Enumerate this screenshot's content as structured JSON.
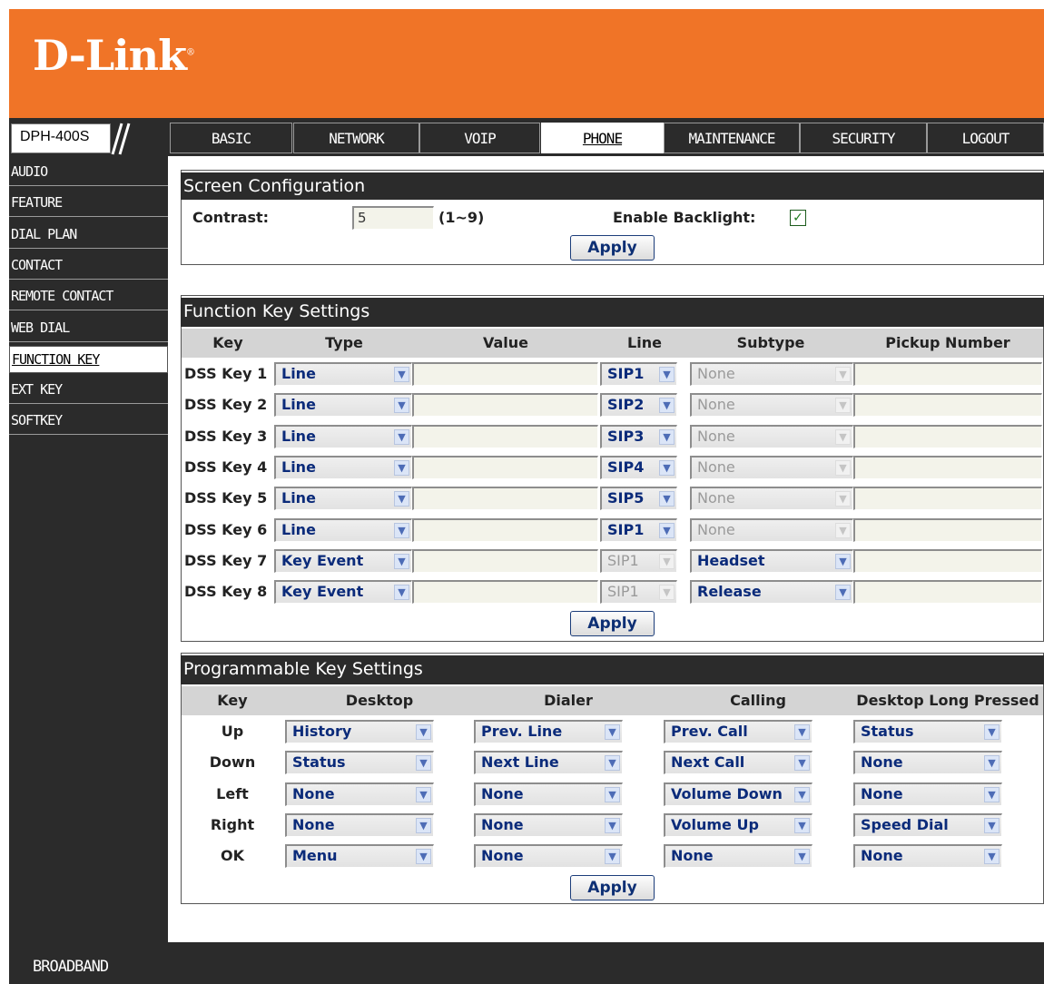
{
  "brand": {
    "logo_text": "D-Link",
    "registered_mark": "®",
    "model": "DPH-400S"
  },
  "nav_tabs": [
    "BASIC",
    "NETWORK",
    "VOIP",
    "PHONE",
    "MAINTENANCE",
    "SECURITY",
    "LOGOUT"
  ],
  "active_tab": "PHONE",
  "sidebar": [
    "AUDIO",
    "FEATURE",
    "DIAL PLAN",
    "CONTACT",
    "REMOTE CONTACT",
    "WEB DIAL",
    "FUNCTION KEY",
    "EXT KEY",
    "SOFTKEY"
  ],
  "active_sidebar": "FUNCTION KEY",
  "screen_config": {
    "title": "Screen Configuration",
    "contrast_label": "Contrast:",
    "contrast_value": "5",
    "contrast_range": "(1~9)",
    "backlight_label": "Enable Backlight:",
    "backlight_checked": true,
    "apply": "Apply"
  },
  "function_keys": {
    "title": "Function Key Settings",
    "headers": {
      "key": "Key",
      "type": "Type",
      "value": "Value",
      "line": "Line",
      "subtype": "Subtype",
      "pickup": "Pickup Number"
    },
    "rows": [
      {
        "key": "DSS Key 1",
        "type": "Line",
        "value": "",
        "line": "SIP1",
        "line_enabled": true,
        "subtype": "None",
        "subtype_enabled": false,
        "pickup": ""
      },
      {
        "key": "DSS Key 2",
        "type": "Line",
        "value": "",
        "line": "SIP2",
        "line_enabled": true,
        "subtype": "None",
        "subtype_enabled": false,
        "pickup": ""
      },
      {
        "key": "DSS Key 3",
        "type": "Line",
        "value": "",
        "line": "SIP3",
        "line_enabled": true,
        "subtype": "None",
        "subtype_enabled": false,
        "pickup": ""
      },
      {
        "key": "DSS Key 4",
        "type": "Line",
        "value": "",
        "line": "SIP4",
        "line_enabled": true,
        "subtype": "None",
        "subtype_enabled": false,
        "pickup": ""
      },
      {
        "key": "DSS Key 5",
        "type": "Line",
        "value": "",
        "line": "SIP5",
        "line_enabled": true,
        "subtype": "None",
        "subtype_enabled": false,
        "pickup": ""
      },
      {
        "key": "DSS Key 6",
        "type": "Line",
        "value": "",
        "line": "SIP1",
        "line_enabled": true,
        "subtype": "None",
        "subtype_enabled": false,
        "pickup": ""
      },
      {
        "key": "DSS Key 7",
        "type": "Key Event",
        "value": "",
        "line": "SIP1",
        "line_enabled": false,
        "subtype": "Headset",
        "subtype_enabled": true,
        "pickup": ""
      },
      {
        "key": "DSS Key 8",
        "type": "Key Event",
        "value": "",
        "line": "SIP1",
        "line_enabled": false,
        "subtype": "Release",
        "subtype_enabled": true,
        "pickup": ""
      }
    ],
    "apply": "Apply"
  },
  "programmable_keys": {
    "title": "Programmable Key Settings",
    "headers": {
      "key": "Key",
      "desktop": "Desktop",
      "dialer": "Dialer",
      "calling": "Calling",
      "long_pressed": "Desktop Long Pressed"
    },
    "rows": [
      {
        "key": "Up",
        "desktop": "History",
        "dialer": "Prev. Line",
        "calling": "Prev. Call",
        "long_pressed": "Status"
      },
      {
        "key": "Down",
        "desktop": "Status",
        "dialer": "Next Line",
        "calling": "Next Call",
        "long_pressed": "None"
      },
      {
        "key": "Left",
        "desktop": "None",
        "dialer": "None",
        "calling": "Volume Down",
        "long_pressed": "None"
      },
      {
        "key": "Right",
        "desktop": "None",
        "dialer": "None",
        "calling": "Volume Up",
        "long_pressed": "Speed Dial"
      },
      {
        "key": "OK",
        "desktop": "Menu",
        "dialer": "None",
        "calling": "None",
        "long_pressed": "None"
      }
    ],
    "apply": "Apply"
  },
  "footer": {
    "text": "BROADBAND"
  },
  "icons": {
    "dropdown": "chevron-down-icon",
    "checkbox": "check-icon"
  },
  "colors": {
    "brand_orange": "#f07427",
    "dark_band": "#2b2b2b",
    "select_text": "#0b2b7a"
  }
}
